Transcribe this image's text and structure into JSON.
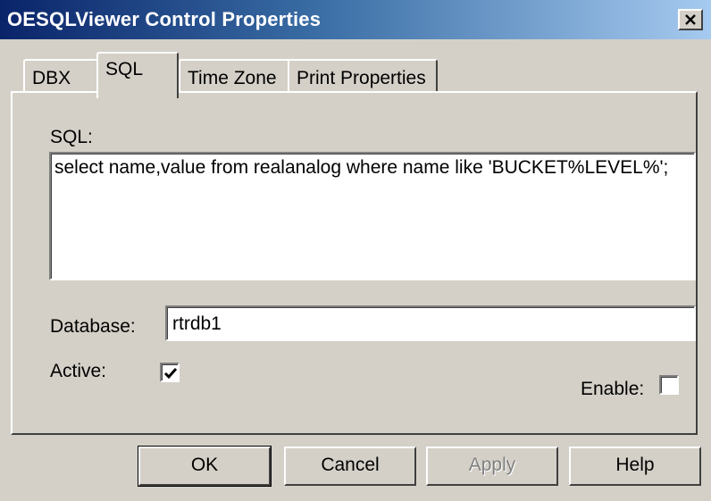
{
  "window": {
    "title": "OESQLViewer Control Properties",
    "close_glyph": "✕"
  },
  "tabs": [
    {
      "label": "DBX",
      "active": false
    },
    {
      "label": "SQL",
      "active": true
    },
    {
      "label": "Time Zone",
      "active": false
    },
    {
      "label": "Print Properties",
      "active": false
    }
  ],
  "sql": {
    "label": "SQL:",
    "value": "select name,value from realanalog where name like 'BUCKET%LEVEL%';"
  },
  "database": {
    "label": "Database:",
    "value": "rtrdb1"
  },
  "active": {
    "label": "Active:",
    "checked": true
  },
  "enable": {
    "label": "Enable:",
    "checked": false
  },
  "buttons": {
    "ok": "OK",
    "cancel": "Cancel",
    "apply": "Apply",
    "help": "Help"
  }
}
